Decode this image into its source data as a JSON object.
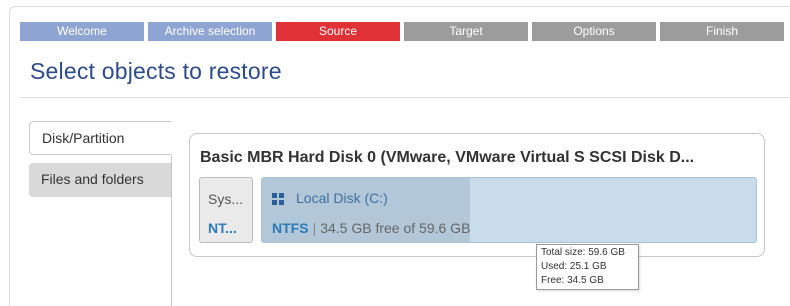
{
  "wizard_steps": [
    {
      "label": "Welcome",
      "state": "done"
    },
    {
      "label": "Archive selection",
      "state": "done"
    },
    {
      "label": "Source",
      "state": "active"
    },
    {
      "label": "Target",
      "state": "todo"
    },
    {
      "label": "Options",
      "state": "todo"
    },
    {
      "label": "Finish",
      "state": "todo"
    }
  ],
  "colors": {
    "step_done": "#8ea4d2",
    "step_active": "#e03236",
    "step_todo": "#9c9c9c",
    "title_blue": "#2c4c8e",
    "fs_blue": "#2b7bb9"
  },
  "page_title": "Select objects to restore",
  "tabs": [
    {
      "label": "Disk/Partition",
      "selected": true
    },
    {
      "label": "Files and folders",
      "selected": false
    }
  ],
  "disk": {
    "title": "Basic MBR Hard Disk 0 (VMware, VMware Virtual S SCSI Disk D...",
    "partitions": [
      {
        "name": "Sys...",
        "fs": "NT..."
      },
      {
        "icon": "windows-icon",
        "name": "Local Disk (C:)",
        "fs": "NTFS",
        "separator": "|",
        "usage": "34.5 GB free of 59.6 GB",
        "used_fraction": 0.421
      }
    ]
  },
  "tooltip": {
    "total": "Total size: 59.6 GB",
    "used": "Used: 25.1 GB",
    "free": "Free: 34.5 GB"
  }
}
